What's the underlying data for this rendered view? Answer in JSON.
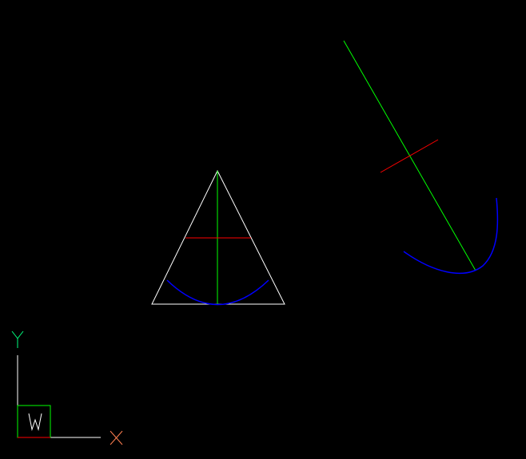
{
  "colors": {
    "background": "#000000",
    "outline": "#FFFFFF",
    "axis_line": "#00FF00",
    "cross_line": "#FF0000",
    "arc": "#0000FF",
    "ucs_x_label": "#FF7F50",
    "ucs_y_label": "#00FF7F",
    "ucs_box": "#FFFFFF"
  },
  "ucs_icon": {
    "x_label": "X",
    "y_label": "Y",
    "wcs_label": "W"
  }
}
